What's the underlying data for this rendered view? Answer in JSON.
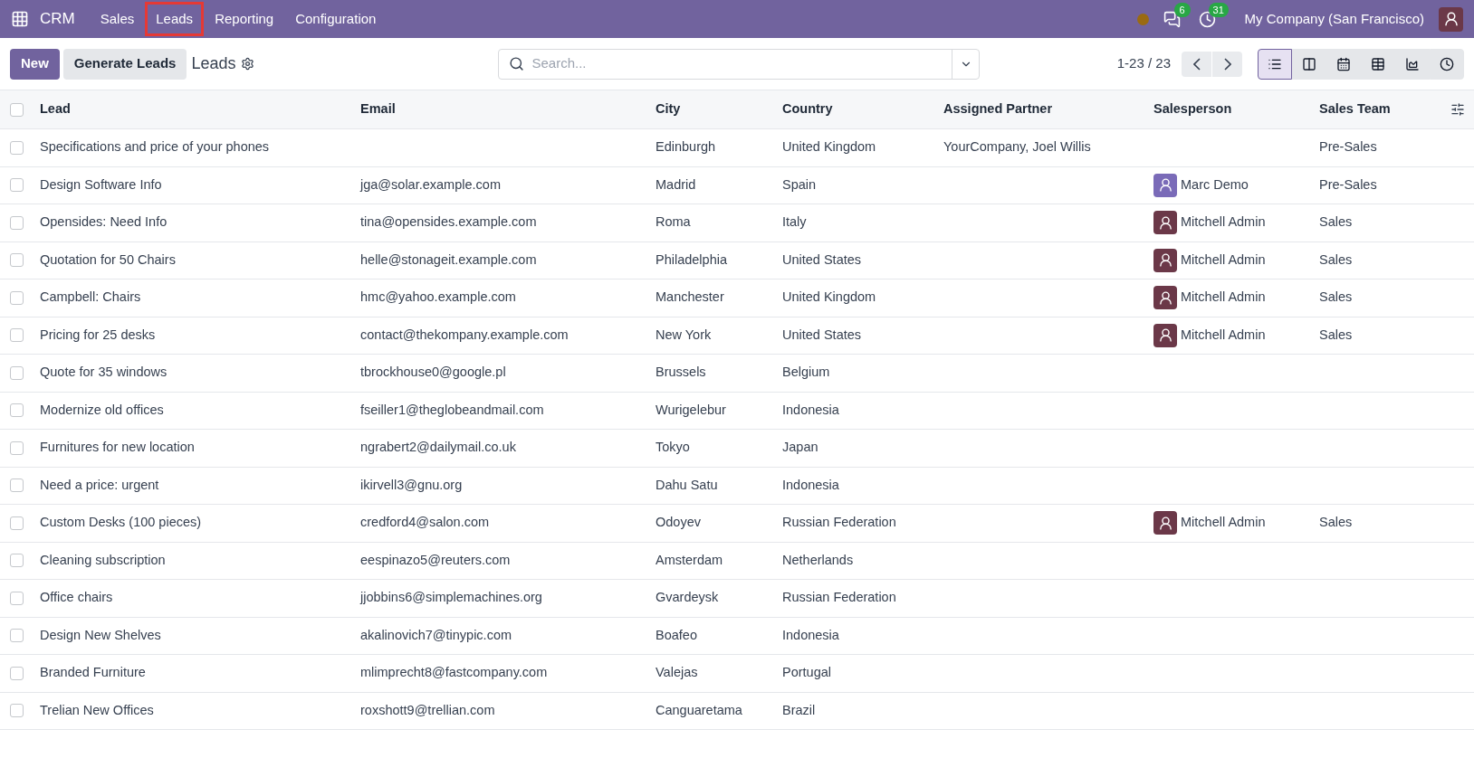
{
  "navbar": {
    "app": "CRM",
    "menu": [
      {
        "label": "Sales",
        "highlighted": false
      },
      {
        "label": "Leads",
        "highlighted": true
      },
      {
        "label": "Reporting",
        "highlighted": false
      },
      {
        "label": "Configuration",
        "highlighted": false
      }
    ],
    "messages_count": "6",
    "activities_count": "31",
    "company": "My Company (San Francisco)"
  },
  "toolbar": {
    "new_button": "New",
    "generate_button": "Generate Leads",
    "title": "Leads",
    "search": {
      "placeholder": "Search..."
    },
    "pager": "1-23 / 23",
    "views": [
      {
        "kind": "list",
        "selected": true
      },
      {
        "kind": "kanban",
        "selected": false
      },
      {
        "kind": "calendar",
        "selected": false
      },
      {
        "kind": "pivot",
        "selected": false
      },
      {
        "kind": "graph",
        "selected": false
      },
      {
        "kind": "activity",
        "selected": false
      }
    ]
  },
  "table": {
    "all_checked": false,
    "columns": [
      "Lead",
      "Email",
      "City",
      "Country",
      "Assigned Partner",
      "Salesperson",
      "Sales Team"
    ],
    "rows": [
      {
        "checked": false,
        "lead": "Specifications and price of your phones",
        "email": "",
        "city": "Edinburgh",
        "country": "United Kingdom",
        "partner": "YourCompany, Joel Willis",
        "salesperson": "",
        "team": "Pre-Sales"
      },
      {
        "checked": false,
        "lead": "Design Software Info",
        "email": "jga@solar.example.com",
        "city": "Madrid",
        "country": "Spain",
        "partner": "",
        "salesperson": "Marc Demo",
        "color": "#7a6bb8",
        "team": "Pre-Sales"
      },
      {
        "checked": false,
        "lead": "Opensides: Need Info",
        "email": "tina@opensides.example.com",
        "city": "Roma",
        "country": "Italy",
        "partner": "",
        "salesperson": "Mitchell Admin",
        "color": "#6b3848",
        "team": "Sales"
      },
      {
        "checked": false,
        "lead": "Quotation for 50 Chairs",
        "email": "helle@stonageit.example.com",
        "city": "Philadelphia",
        "country": "United States",
        "partner": "",
        "salesperson": "Mitchell Admin",
        "color": "#6b3848",
        "team": "Sales"
      },
      {
        "checked": false,
        "lead": "Campbell: Chairs",
        "email": "hmc@yahoo.example.com",
        "city": "Manchester",
        "country": "United Kingdom",
        "partner": "",
        "salesperson": "Mitchell Admin",
        "color": "#6b3848",
        "team": "Sales"
      },
      {
        "checked": false,
        "lead": "Pricing for 25 desks",
        "email": "contact@thekompany.example.com",
        "city": "New York",
        "country": "United States",
        "partner": "",
        "salesperson": "Mitchell Admin",
        "color": "#6b3848",
        "team": "Sales"
      },
      {
        "checked": false,
        "lead": "Quote for 35 windows",
        "email": "tbrockhouse0@google.pl",
        "city": "Brussels",
        "country": "Belgium",
        "partner": "",
        "salesperson": "",
        "team": ""
      },
      {
        "checked": false,
        "lead": "Modernize old offices",
        "email": "fseiller1@theglobeandmail.com",
        "city": "Wurigelebur",
        "country": "Indonesia",
        "partner": "",
        "salesperson": "",
        "team": ""
      },
      {
        "checked": false,
        "lead": "Furnitures for new location",
        "email": "ngrabert2@dailymail.co.uk",
        "city": "Tokyo",
        "country": "Japan",
        "partner": "",
        "salesperson": "",
        "team": ""
      },
      {
        "checked": false,
        "lead": "Need a price: urgent",
        "email": "ikirvell3@gnu.org",
        "city": "Dahu Satu",
        "country": "Indonesia",
        "partner": "",
        "salesperson": "",
        "team": ""
      },
      {
        "checked": false,
        "lead": "Custom Desks (100 pieces)",
        "email": "credford4@salon.com",
        "city": "Odoyev",
        "country": "Russian Federation",
        "partner": "",
        "salesperson": "Mitchell Admin",
        "color": "#6b3848",
        "team": "Sales"
      },
      {
        "checked": false,
        "lead": "Cleaning subscription",
        "email": "eespinazo5@reuters.com",
        "city": "Amsterdam",
        "country": "Netherlands",
        "partner": "",
        "salesperson": "",
        "team": ""
      },
      {
        "checked": false,
        "lead": "Office chairs",
        "email": "jjobbins6@simplemachines.org",
        "city": "Gvardeysk",
        "country": "Russian Federation",
        "partner": "",
        "salesperson": "",
        "team": ""
      },
      {
        "checked": false,
        "lead": "Design New Shelves",
        "email": "akalinovich7@tinypic.com",
        "city": "Boafeo",
        "country": "Indonesia",
        "partner": "",
        "salesperson": "",
        "team": ""
      },
      {
        "checked": false,
        "lead": "Branded Furniture",
        "email": "mlimprecht8@fastcompany.com",
        "city": "Valejas",
        "country": "Portugal",
        "partner": "",
        "salesperson": "",
        "team": ""
      },
      {
        "checked": false,
        "lead": "Trelian New Offices",
        "email": "roxshott9@trellian.com",
        "city": "Canguaretama",
        "country": "Brazil",
        "partner": "",
        "salesperson": "",
        "team": ""
      }
    ]
  }
}
